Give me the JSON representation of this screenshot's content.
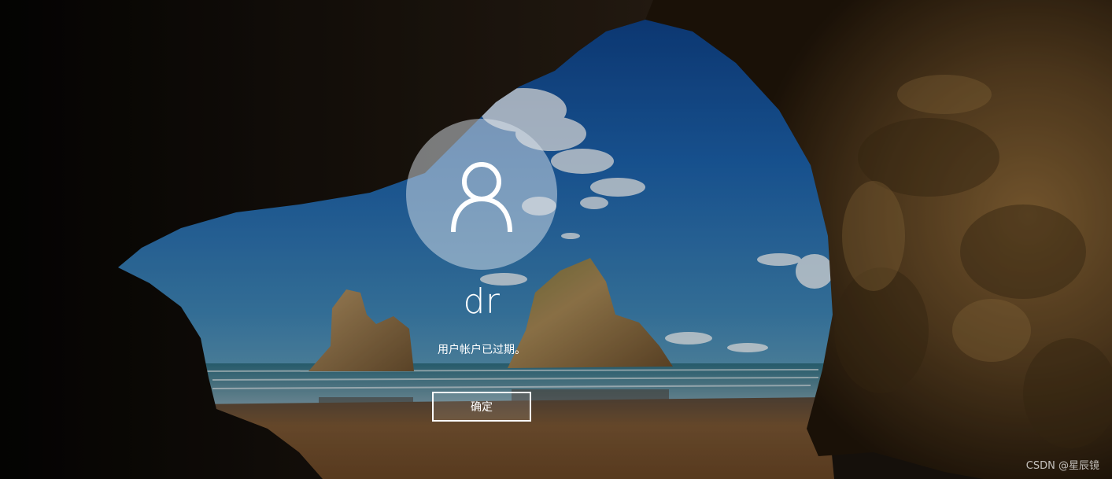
{
  "lock_screen": {
    "background_description_colors": {
      "sky": "#1e5fa8",
      "rock": "#6b4e2c",
      "sand": "#7a5530",
      "sea": "#3e7d8c"
    },
    "avatar_icon": "user-icon",
    "username": "dr",
    "message": "用户帐户已过期。",
    "ok_button_label": "确定"
  },
  "watermark": {
    "text": "CSDN @星辰镜"
  }
}
